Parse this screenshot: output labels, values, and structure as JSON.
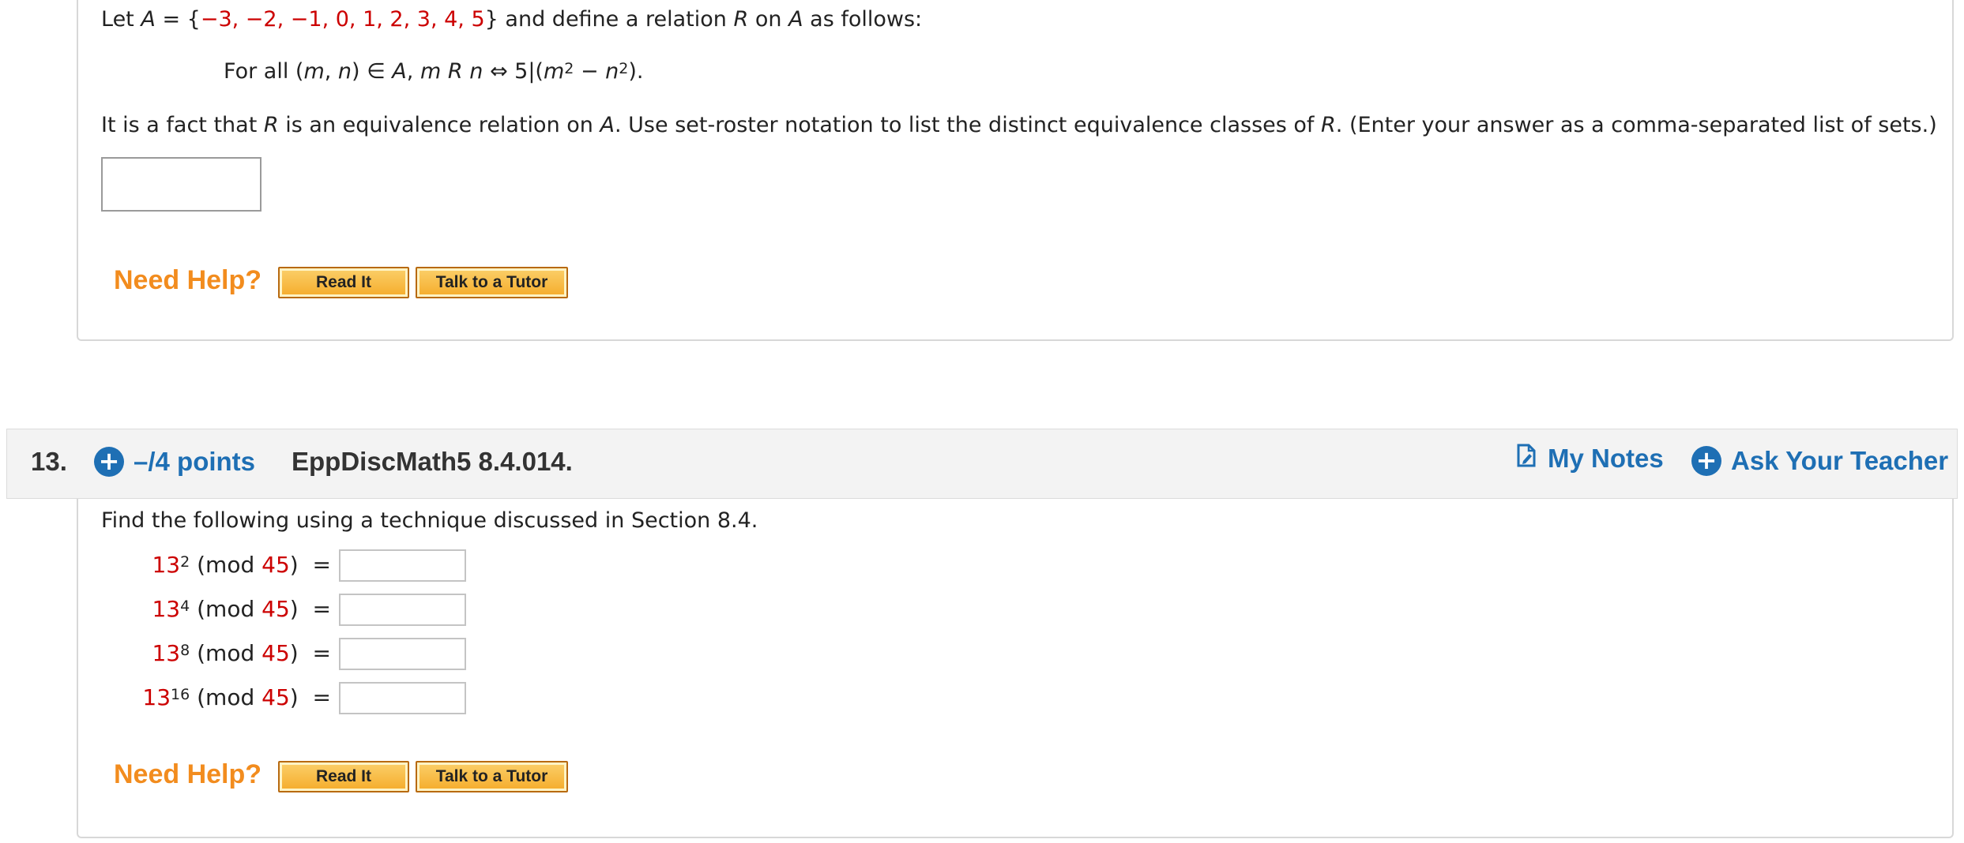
{
  "q12": {
    "line1": {
      "prefix": "Let",
      "A": "A",
      "eq": "=",
      "brace_open": "{",
      "set_values": "−3, −2, −1, 0, 1, 2, 3, 4, 5",
      "brace_close": "}",
      "middle": "and define a relation",
      "R": "R",
      "on": "on",
      "A2": "A",
      "suffix": "as follows:"
    },
    "line2": {
      "for_all": "For all (",
      "m": "m",
      "comma": ", ",
      "n": "n",
      "close_in": ") ∈",
      "A": "A",
      "sep": ",",
      "m2": "m",
      "R": "R",
      "n2": "n",
      "iff": "⇔ 5|(",
      "m3": "m",
      "exp1": "2",
      "minus": " − ",
      "n3": "n",
      "exp2": "2",
      "end": ")."
    },
    "line3": {
      "part1": "It is a fact that",
      "R": "R",
      "part2": "is an equivalence relation on",
      "A": "A",
      "part3": ". Use set-roster notation to list the distinct equivalence classes of",
      "R2": "R",
      "part4": ". (Enter your answer as a comma-separated list of sets.)"
    },
    "answer_value": "",
    "need_help": "Need Help?",
    "read_it": "Read It",
    "talk_tutor": "Talk to a Tutor"
  },
  "q13": {
    "number": "13.",
    "points": "–/4 points",
    "id": "EppDiscMath5 8.4.014.",
    "my_notes": "My Notes",
    "ask_teacher": "Ask Your Teacher",
    "plus_symbol": "+",
    "instruction": "Find the following using a technique discussed in Section 8.4.",
    "rows": [
      {
        "base": "13",
        "exp": "2",
        "mod_open": "(mod",
        "modulus": "45",
        "mod_close": ")",
        "eq": "=",
        "value": ""
      },
      {
        "base": "13",
        "exp": "4",
        "mod_open": "(mod",
        "modulus": "45",
        "mod_close": ")",
        "eq": "=",
        "value": ""
      },
      {
        "base": "13",
        "exp": "8",
        "mod_open": "(mod",
        "modulus": "45",
        "mod_close": ")",
        "eq": "=",
        "value": ""
      },
      {
        "base": "13",
        "exp": "16",
        "mod_open": "(mod",
        "modulus": "45",
        "mod_close": ")",
        "eq": "=",
        "value": ""
      }
    ],
    "need_help": "Need Help?",
    "read_it": "Read It",
    "talk_tutor": "Talk to a Tutor"
  },
  "colors": {
    "accent_blue": "#1e6fb4",
    "help_orange": "#f28c1e",
    "math_red": "#cc0000"
  }
}
